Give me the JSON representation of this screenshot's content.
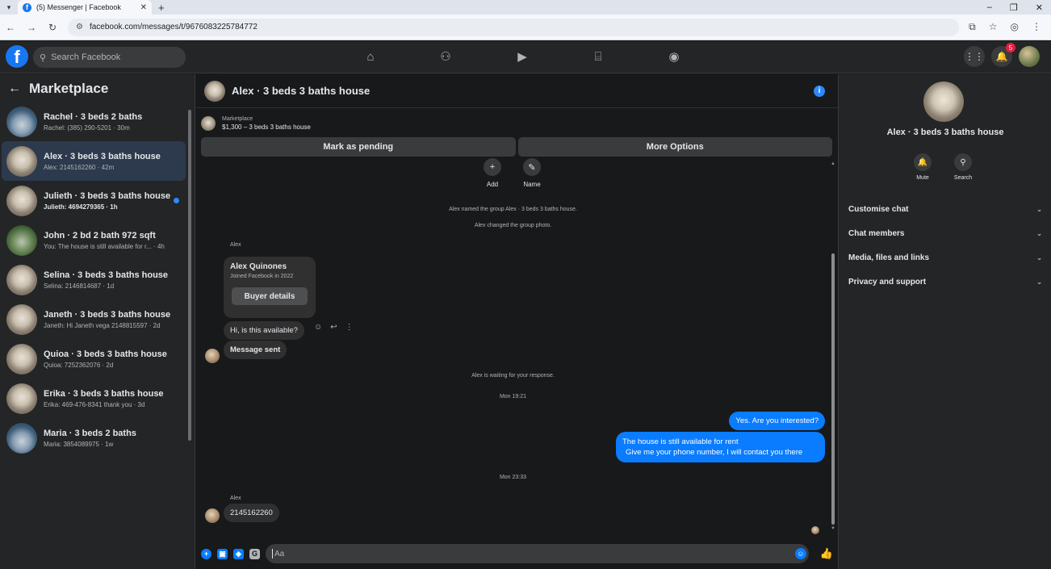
{
  "browser": {
    "tab_title": "(5) Messenger | Facebook",
    "url": "facebook.com/messages/t/9676083225784772"
  },
  "fbnav": {
    "search_placeholder": "Search Facebook",
    "notification_count": "5"
  },
  "left": {
    "title": "Marketplace",
    "conversations": [
      {
        "name": "Rachel · 3 beds 2 baths",
        "preview": "Rachel: (385) 290-5201 · 30m"
      },
      {
        "name": "Alex · 3 beds 3 baths house",
        "preview": "Alex: 2145162260 · 42m"
      },
      {
        "name": "Julieth · 3 beds 3 baths house",
        "preview": "Julieth: 4694279365 · 1h"
      },
      {
        "name": "John · 2 bd 2 bath 972 sqft",
        "preview": "You: The house is still available for r... · 4h"
      },
      {
        "name": "Selina · 3 beds 3 baths house",
        "preview": "Selina: 2146814687 · 1d"
      },
      {
        "name": "Janeth · 3 beds 3 baths house",
        "preview": "Janeth: Hi Janeth vega 2148815597 · 2d"
      },
      {
        "name": "Quioa · 3 beds 3 baths house",
        "preview": "Quioa: 7252362076 · 2d"
      },
      {
        "name": "Erika · 3 beds 3 baths house",
        "preview": "Erika: 469-476-8341 thank you · 3d"
      },
      {
        "name": "Maria · 3 beds 2 baths",
        "preview": "Maria: 3854089975 · 1w"
      }
    ]
  },
  "chat": {
    "title": "Alex · 3 beds 3 baths house",
    "listing_source": "Marketplace",
    "listing_price": "$1,300 – 3 beds 3 baths house",
    "mark_pending": "Mark as pending",
    "more_options": "More Options",
    "quick_add": "Add",
    "quick_name": "Name",
    "sys_named": "Alex named the group Alex · 3 beds 3 baths house.",
    "sys_photo": "Alex changed the group photo.",
    "sender_1": "Alex",
    "card_name": "Alex Quinones",
    "card_joined": "Joined Facebook in 2022",
    "card_button": "Buyer details",
    "msg_available": "Hi, is this available?",
    "msg_sent": "Message sent",
    "sys_waiting": "Alex is waiting for your response.",
    "time_1": "Mon 19:21",
    "my_msg_1": "Yes. Are you interested?",
    "my_msg_2_line1": "The house is still available for rent",
    "my_msg_2_line2": "Give me your phone number, I will contact you there",
    "time_2": "Mon 23:33",
    "sender_2": "Alex",
    "msg_phone": "2145162260",
    "input_placeholder": "Aa"
  },
  "right": {
    "title": "Alex · 3 beds 3 baths house",
    "mute": "Mute",
    "search": "Search",
    "sections": [
      "Customise chat",
      "Chat members",
      "Media, files and links",
      "Privacy and support"
    ]
  }
}
